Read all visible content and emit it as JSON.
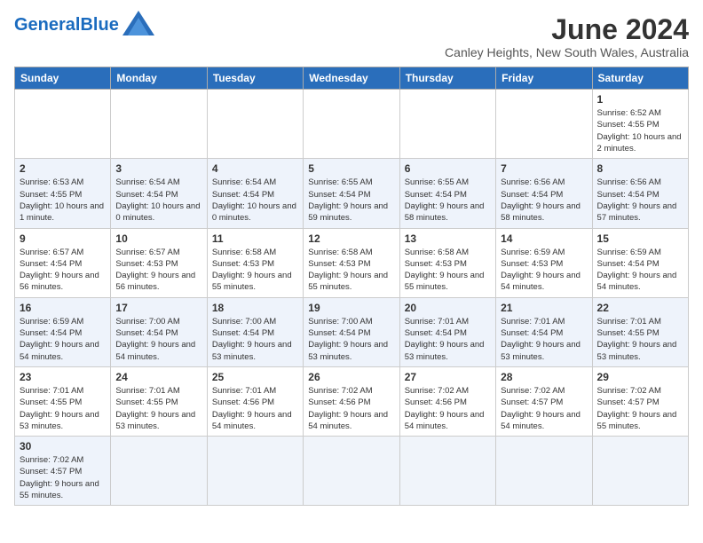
{
  "header": {
    "logo_general": "General",
    "logo_blue": "Blue",
    "month_title": "June 2024",
    "subtitle": "Canley Heights, New South Wales, Australia"
  },
  "weekdays": [
    "Sunday",
    "Monday",
    "Tuesday",
    "Wednesday",
    "Thursday",
    "Friday",
    "Saturday"
  ],
  "weeks": [
    [
      {
        "day": "",
        "info": ""
      },
      {
        "day": "",
        "info": ""
      },
      {
        "day": "",
        "info": ""
      },
      {
        "day": "",
        "info": ""
      },
      {
        "day": "",
        "info": ""
      },
      {
        "day": "",
        "info": ""
      },
      {
        "day": "1",
        "info": "Sunrise: 6:52 AM\nSunset: 4:55 PM\nDaylight: 10 hours and 2 minutes."
      }
    ],
    [
      {
        "day": "2",
        "info": "Sunrise: 6:53 AM\nSunset: 4:55 PM\nDaylight: 10 hours and 1 minute."
      },
      {
        "day": "3",
        "info": "Sunrise: 6:54 AM\nSunset: 4:54 PM\nDaylight: 10 hours and 0 minutes."
      },
      {
        "day": "4",
        "info": "Sunrise: 6:54 AM\nSunset: 4:54 PM\nDaylight: 10 hours and 0 minutes."
      },
      {
        "day": "5",
        "info": "Sunrise: 6:55 AM\nSunset: 4:54 PM\nDaylight: 9 hours and 59 minutes."
      },
      {
        "day": "6",
        "info": "Sunrise: 6:55 AM\nSunset: 4:54 PM\nDaylight: 9 hours and 58 minutes."
      },
      {
        "day": "7",
        "info": "Sunrise: 6:56 AM\nSunset: 4:54 PM\nDaylight: 9 hours and 58 minutes."
      },
      {
        "day": "8",
        "info": "Sunrise: 6:56 AM\nSunset: 4:54 PM\nDaylight: 9 hours and 57 minutes."
      }
    ],
    [
      {
        "day": "9",
        "info": "Sunrise: 6:57 AM\nSunset: 4:54 PM\nDaylight: 9 hours and 56 minutes."
      },
      {
        "day": "10",
        "info": "Sunrise: 6:57 AM\nSunset: 4:53 PM\nDaylight: 9 hours and 56 minutes."
      },
      {
        "day": "11",
        "info": "Sunrise: 6:58 AM\nSunset: 4:53 PM\nDaylight: 9 hours and 55 minutes."
      },
      {
        "day": "12",
        "info": "Sunrise: 6:58 AM\nSunset: 4:53 PM\nDaylight: 9 hours and 55 minutes."
      },
      {
        "day": "13",
        "info": "Sunrise: 6:58 AM\nSunset: 4:53 PM\nDaylight: 9 hours and 55 minutes."
      },
      {
        "day": "14",
        "info": "Sunrise: 6:59 AM\nSunset: 4:53 PM\nDaylight: 9 hours and 54 minutes."
      },
      {
        "day": "15",
        "info": "Sunrise: 6:59 AM\nSunset: 4:54 PM\nDaylight: 9 hours and 54 minutes."
      }
    ],
    [
      {
        "day": "16",
        "info": "Sunrise: 6:59 AM\nSunset: 4:54 PM\nDaylight: 9 hours and 54 minutes."
      },
      {
        "day": "17",
        "info": "Sunrise: 7:00 AM\nSunset: 4:54 PM\nDaylight: 9 hours and 54 minutes."
      },
      {
        "day": "18",
        "info": "Sunrise: 7:00 AM\nSunset: 4:54 PM\nDaylight: 9 hours and 53 minutes."
      },
      {
        "day": "19",
        "info": "Sunrise: 7:00 AM\nSunset: 4:54 PM\nDaylight: 9 hours and 53 minutes."
      },
      {
        "day": "20",
        "info": "Sunrise: 7:01 AM\nSunset: 4:54 PM\nDaylight: 9 hours and 53 minutes."
      },
      {
        "day": "21",
        "info": "Sunrise: 7:01 AM\nSunset: 4:54 PM\nDaylight: 9 hours and 53 minutes."
      },
      {
        "day": "22",
        "info": "Sunrise: 7:01 AM\nSunset: 4:55 PM\nDaylight: 9 hours and 53 minutes."
      }
    ],
    [
      {
        "day": "23",
        "info": "Sunrise: 7:01 AM\nSunset: 4:55 PM\nDaylight: 9 hours and 53 minutes."
      },
      {
        "day": "24",
        "info": "Sunrise: 7:01 AM\nSunset: 4:55 PM\nDaylight: 9 hours and 53 minutes."
      },
      {
        "day": "25",
        "info": "Sunrise: 7:01 AM\nSunset: 4:56 PM\nDaylight: 9 hours and 54 minutes."
      },
      {
        "day": "26",
        "info": "Sunrise: 7:02 AM\nSunset: 4:56 PM\nDaylight: 9 hours and 54 minutes."
      },
      {
        "day": "27",
        "info": "Sunrise: 7:02 AM\nSunset: 4:56 PM\nDaylight: 9 hours and 54 minutes."
      },
      {
        "day": "28",
        "info": "Sunrise: 7:02 AM\nSunset: 4:57 PM\nDaylight: 9 hours and 54 minutes."
      },
      {
        "day": "29",
        "info": "Sunrise: 7:02 AM\nSunset: 4:57 PM\nDaylight: 9 hours and 55 minutes."
      }
    ],
    [
      {
        "day": "30",
        "info": "Sunrise: 7:02 AM\nSunset: 4:57 PM\nDaylight: 9 hours and 55 minutes."
      },
      {
        "day": "",
        "info": ""
      },
      {
        "day": "",
        "info": ""
      },
      {
        "day": "",
        "info": ""
      },
      {
        "day": "",
        "info": ""
      },
      {
        "day": "",
        "info": ""
      },
      {
        "day": "",
        "info": ""
      }
    ]
  ]
}
